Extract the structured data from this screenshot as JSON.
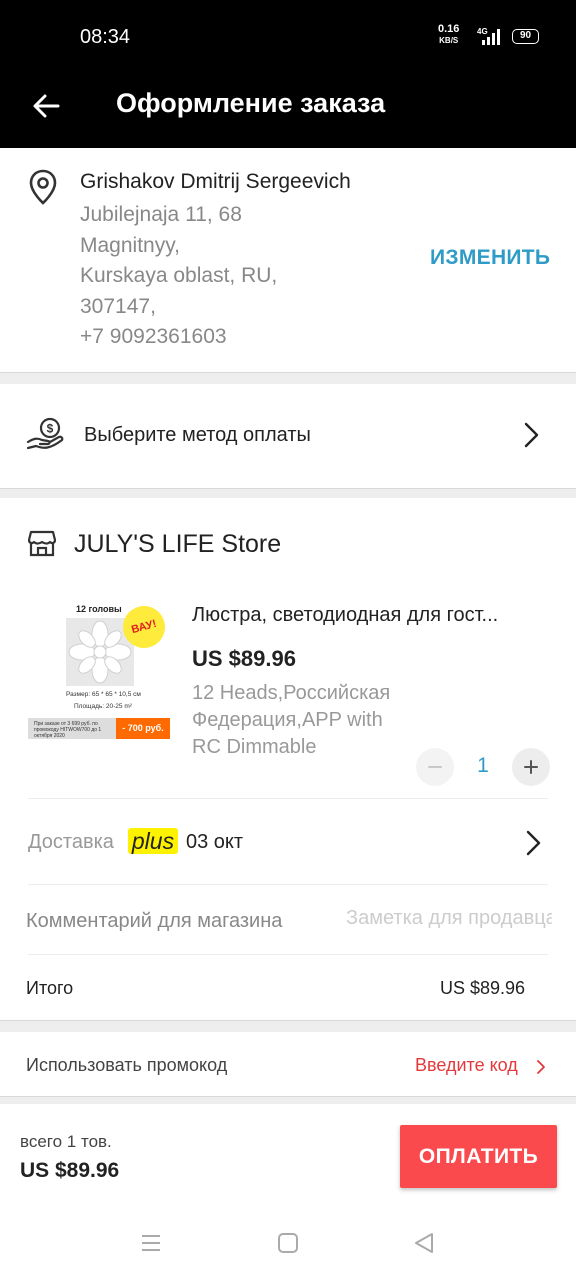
{
  "status_bar": {
    "time": "08:34",
    "speed_value": "0.16",
    "speed_unit": "KB/S",
    "network": "4G",
    "battery": "90"
  },
  "app_bar": {
    "back_icon": "arrow-left-icon",
    "title": "Оформление заказа"
  },
  "address": {
    "icon": "location-pin-icon",
    "name": "Grishakov Dmitrij Sergeevich",
    "line1": "Jubilejnaja 11, 68",
    "line2": "Magnitnyy,",
    "line3": "Kurskaya oblast, RU,",
    "line4": "307147,",
    "phone": "+7 9092361603",
    "change_label": "ИЗМЕНИТЬ"
  },
  "payment": {
    "icon": "hand-coin-icon",
    "label": "Выберите метод оплаты"
  },
  "store": {
    "icon": "storefront-icon",
    "name": "JULY'S LIFE Store"
  },
  "product": {
    "image_heading": "12 головы",
    "image_badge": "ВАУ!",
    "image_spec_size": "Размер: 65 * 65 * 10,5 см",
    "image_spec_area": "Площадь: 20-25 m²",
    "image_promo": "При заказе от 3 699 руб. по промокоду HITWOW700 до 1 октября 2020",
    "image_discount": "- 700 руб.",
    "title": "Люстра, светодиодная для гост...",
    "price": "US $89.96",
    "variant": "12 Heads,Российская Федерация,APP with RC Dimmable",
    "quantity": "1"
  },
  "delivery": {
    "label": "Доставка",
    "badge": "plus",
    "date": "03 окт"
  },
  "comment": {
    "label": "Комментарий для магазина",
    "placeholder": "Заметка для продавца"
  },
  "total": {
    "label": "Итого",
    "value": "US $89.96"
  },
  "promo": {
    "label": "Использовать промокод",
    "enter_label": "Введите код"
  },
  "checkout": {
    "count": "всего 1 тов.",
    "sum": "US $89.96",
    "pay_label": "ОПЛАТИТЬ"
  },
  "colors": {
    "accent_blue": "#2f9cc7",
    "pay_red": "#fb4a4e",
    "promo_red": "#e4393c",
    "plus_yellow": "#fff200"
  }
}
